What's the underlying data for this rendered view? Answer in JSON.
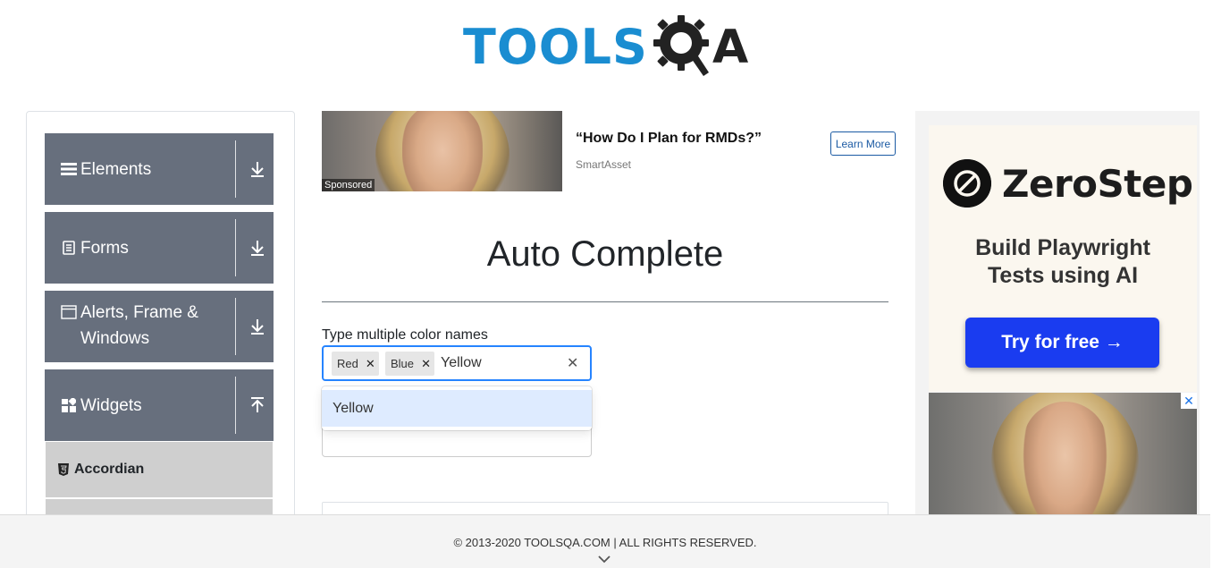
{
  "header": {
    "logo_text": "TOOLS",
    "logo_a": "A",
    "logo_alt": "TOOLSQA"
  },
  "sidebar": {
    "groups": [
      {
        "title": "Elements",
        "icon": "hamburger-icon",
        "toggle": "download-arrow-icon"
      },
      {
        "title": "Forms",
        "icon": "document-icon",
        "toggle": "download-arrow-icon"
      },
      {
        "title": "Alerts, Frame &",
        "title2": "Windows",
        "icon": "window-icon",
        "toggle": "download-arrow-icon"
      },
      {
        "title": "Widgets",
        "icon": "widgets-icon",
        "toggle": "upload-arrow-icon"
      }
    ],
    "items": [
      {
        "label": "Accordian",
        "icon": "html5-icon"
      }
    ]
  },
  "ad_top": {
    "sponsored": "Sponsored",
    "headline": "“How Do I Plan for RMDs?”",
    "source": "SmartAsset",
    "cta": "Learn More"
  },
  "main": {
    "title": "Auto Complete",
    "multi_label": "Type multiple color names",
    "chips": [
      "Red",
      "Blue"
    ],
    "typed_value": "Yellow",
    "dropdown_options": [
      "Yellow"
    ]
  },
  "right_ad": {
    "brand": "ZeroStep",
    "tagline_1": "Build Playwright",
    "tagline_2": "Tests using AI",
    "cta": "Try for free →",
    "close": "✕"
  },
  "footer": {
    "text": "© 2013-2020 TOOLSQA.COM | ALL RIGHTS RESERVED."
  },
  "colors": {
    "accent": "#1a8dd1",
    "sidebar_group": "#676f7d",
    "focus_border": "#2684ff",
    "option_highlight": "#deebff",
    "cta_blue": "#1a3cf0"
  }
}
